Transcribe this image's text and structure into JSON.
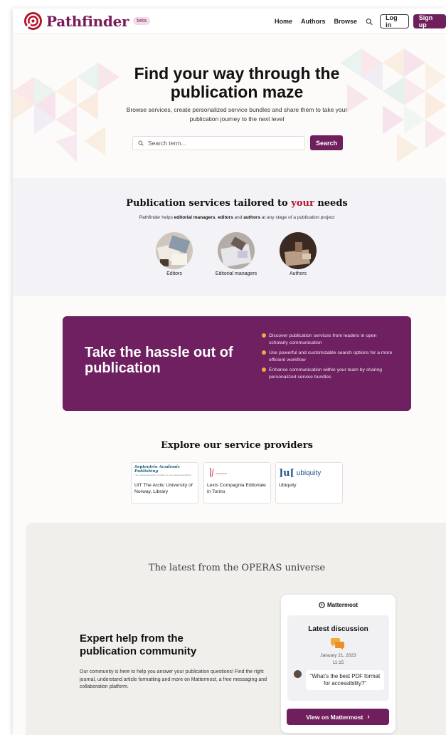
{
  "header": {
    "brand": "Pathfinder",
    "badge": "beta",
    "nav": [
      "Home",
      "Authors",
      "Browse"
    ],
    "login": "Log in",
    "signup": "Sign up"
  },
  "hero": {
    "title_line1": "Find your way through the",
    "title_line2": "publication maze",
    "subtitle_line1": "Browse services, create personalized service bundles and share them to take your",
    "subtitle_line2": "publication journey to the next level",
    "search_placeholder": "Search term...",
    "search_button": "Search"
  },
  "services": {
    "title_pre": "Publication services tailored to ",
    "title_hl": "your",
    "title_post": " needs",
    "subtitle_pre": "Pathfinder helps ",
    "subtitle_b1": "editorial managers",
    "subtitle_mid1": ", ",
    "subtitle_b2": "editors",
    "subtitle_mid2": " and ",
    "subtitle_b3": "authors",
    "subtitle_post": " at any stage of a publication project",
    "roles": [
      "Editors",
      "Editorial managers",
      "Authors"
    ]
  },
  "banner": {
    "title": "Take the hassle out of publication",
    "points": [
      "Discover publication services from leaders in open scholarly communication",
      "Use powerful and customizable search options for a more efficient workflow",
      "Enhance communication within your team by sharing personalized service bundles"
    ]
  },
  "providers": {
    "title": "Explore our service providers",
    "items": [
      {
        "logo": "Septentrio Academic Publishing",
        "logo_sub": "The institutional service provider for open access publishing",
        "name": "UiT The Arctic University of Norway, Library"
      },
      {
        "logo": "LC",
        "name": "Lexis Compagnia Editoriale in Torino"
      },
      {
        "logo": "ubiquity",
        "name": "Ubiquity"
      }
    ]
  },
  "operas": {
    "title": "The latest from the OPERAS universe",
    "heading": "Expert help from the publication community",
    "text": "Our community is here to help you answer your publication questions! Find the right journal, understand article formatting and more on Mattermost, a free messaging and collaboration platform.",
    "mattermost": {
      "brand": "Mattermost",
      "latest": "Latest discussion",
      "date": "January 21, 2023",
      "time": "11:15",
      "question": "“What’s the best PDF format for accessibility?”",
      "button": "View on Mattermost"
    }
  },
  "colors": {
    "brand": "#6f1f5c",
    "accent_red": "#b4152b",
    "bullet": "#f4a93c"
  }
}
